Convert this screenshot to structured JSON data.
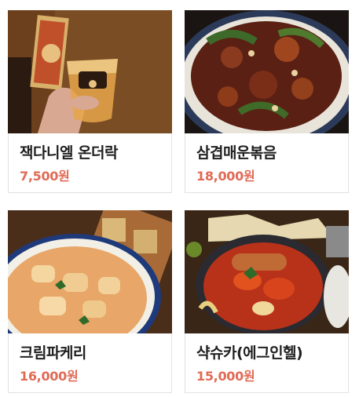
{
  "menu": {
    "items": [
      {
        "name": "잭다니엘 온더락",
        "price": "7,500원",
        "photo": "whiskey-glass-photo"
      },
      {
        "name": "삼겹매운볶음",
        "price": "18,000원",
        "photo": "spicy-pork-stirfry-photo"
      },
      {
        "name": "크림파케리",
        "price": "16,000원",
        "photo": "cream-paccheri-pasta-photo"
      },
      {
        "name": "샥슈카(에그인헬)",
        "price": "15,000원",
        "photo": "shakshuka-photo"
      }
    ]
  },
  "colors": {
    "price": "#e06a55",
    "name": "#1f1f1f",
    "border": "#e2e2e2"
  }
}
